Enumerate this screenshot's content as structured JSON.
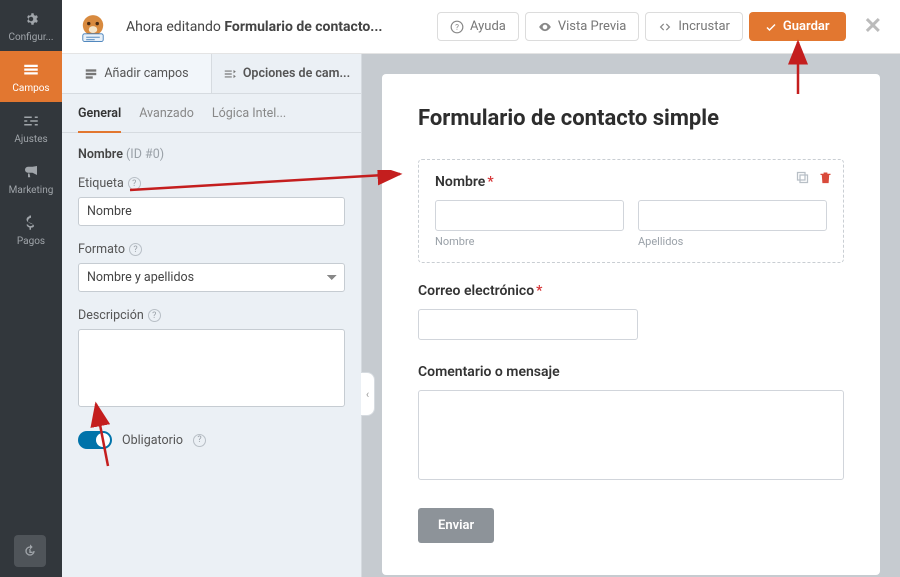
{
  "header": {
    "editing_prefix": "Ahora editando ",
    "form_name": "Formulario de contacto...",
    "help": "Ayuda",
    "preview": "Vista Previa",
    "embed": "Incrustar",
    "save": "Guardar"
  },
  "sidenav": {
    "setup": "Configur...",
    "fields": "Campos",
    "settings": "Ajustes",
    "marketing": "Marketing",
    "payments": "Pagos"
  },
  "panel": {
    "tabs": {
      "add": "Añadir campos",
      "options": "Opciones de cam..."
    },
    "subtabs": {
      "general": "General",
      "advanced": "Avanzado",
      "logic": "Lógica Intel..."
    },
    "field_heading": "Nombre",
    "field_id": "(ID #0)",
    "label_lbl": "Etiqueta",
    "label_value": "Nombre",
    "format_lbl": "Formato",
    "format_value": "Nombre y apellidos",
    "desc_lbl": "Descripción",
    "required_lbl": "Obligatorio"
  },
  "preview": {
    "title": "Formulario de contacto simple",
    "name_label": "Nombre",
    "first_sub": "Nombre",
    "last_sub": "Apellidos",
    "email_label": "Correo electrónico",
    "message_label": "Comentario o mensaje",
    "submit": "Enviar"
  }
}
